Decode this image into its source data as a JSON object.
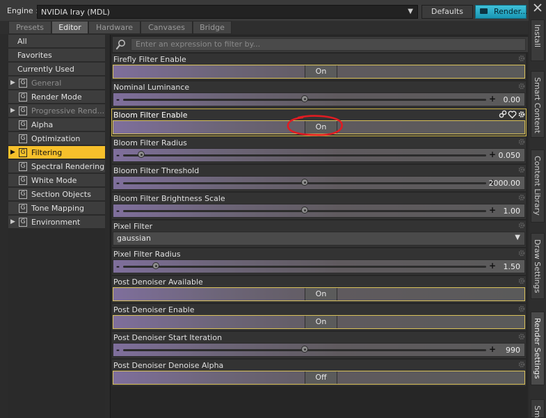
{
  "engine": {
    "label": "Engine :",
    "value": "NVIDIA Iray (MDL)"
  },
  "buttons": {
    "defaults": "Defaults",
    "render": "Render..."
  },
  "tabs": [
    "Presets",
    "Editor",
    "Hardware",
    "Canvases",
    "Bridge"
  ],
  "active_tab": "Editor",
  "sidebar": {
    "top_items": [
      "All",
      "Favorites",
      "Currently Used"
    ],
    "groups": [
      {
        "label": "General",
        "expandable": true,
        "dim": true
      },
      {
        "label": "Render Mode",
        "expandable": false
      },
      {
        "label": "Progressive Rend...",
        "expandable": true,
        "dim": true
      },
      {
        "label": "Alpha",
        "expandable": false
      },
      {
        "label": "Optimization",
        "expandable": false
      },
      {
        "label": "Filtering",
        "expandable": true,
        "active": true
      },
      {
        "label": "Spectral Rendering",
        "expandable": false
      },
      {
        "label": "White Mode",
        "expandable": false
      },
      {
        "label": "Section Objects",
        "expandable": false
      },
      {
        "label": "Tone Mapping",
        "expandable": false
      },
      {
        "label": "Environment",
        "expandable": true
      }
    ],
    "group_icon_letter": "G"
  },
  "filter": {
    "placeholder": "Enter an expression to filter by..."
  },
  "properties": [
    {
      "label": "Firefly Filter Enable",
      "kind": "bool",
      "value": "On"
    },
    {
      "label": "Nominal Luminance",
      "kind": "slider",
      "value": "0.00",
      "position": 0.5
    },
    {
      "label": "Bloom Filter Enable",
      "kind": "bool",
      "value": "On",
      "highlight": true
    },
    {
      "label": "Bloom Filter Radius",
      "kind": "slider",
      "value": "0.050",
      "position": 0.05
    },
    {
      "label": "Bloom Filter Threshold",
      "kind": "slider",
      "value": "2000.00",
      "position": 0.5
    },
    {
      "label": "Bloom Filter Brightness Scale",
      "kind": "slider",
      "value": "1.00",
      "position": 0.5
    },
    {
      "label": "Pixel Filter",
      "kind": "dropdown",
      "value": "gaussian"
    },
    {
      "label": "Pixel Filter Radius",
      "kind": "slider",
      "value": "1.50",
      "position": 0.09
    },
    {
      "label": "Post Denoiser Available",
      "kind": "bool",
      "value": "On"
    },
    {
      "label": "Post Denoiser Enable",
      "kind": "bool",
      "value": "On"
    },
    {
      "label": "Post Denoiser Start Iteration",
      "kind": "slider",
      "value": "990",
      "position": 0.5
    },
    {
      "label": "Post Denoiser Denoise Alpha",
      "kind": "bool",
      "value": "Off"
    }
  ],
  "right_tabs": [
    "Install",
    "Smart Content",
    "Content Library",
    "Draw Settings",
    "Render Settings",
    "Sm"
  ],
  "active_right_tab": "Render Settings",
  "colors": {
    "accent": "#f7c02b",
    "render_button": "#1a97b4",
    "annotation": "#e01c22"
  }
}
